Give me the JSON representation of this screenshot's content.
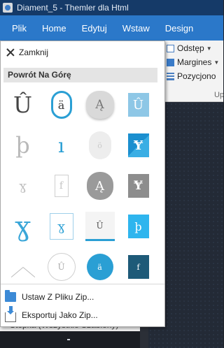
{
  "window": {
    "title": "Diament_5 - Themler dla Html"
  },
  "menu": [
    {
      "label": "Plik"
    },
    {
      "label": "Home"
    },
    {
      "label": "Edytuj"
    },
    {
      "label": "Wstaw"
    },
    {
      "label": "Design"
    }
  ],
  "ribbon": {
    "spacing_label": "Odstęp",
    "margins_label": "Margines",
    "position_label": "Pozycjono",
    "group_label": "Up"
  },
  "panel": {
    "close_label": "Zamknij",
    "section_title": "Powrót Na Górę",
    "styles": [
      {
        "glyph": "Û"
      },
      {
        "glyph": "ä"
      },
      {
        "glyph": "Ą"
      },
      {
        "glyph": "Û"
      },
      {
        "glyph": "þ"
      },
      {
        "glyph": "ı"
      },
      {
        "glyph": "ö"
      },
      {
        "glyph": "Ɏ"
      },
      {
        "glyph": "ɣ"
      },
      {
        "glyph": "f"
      },
      {
        "glyph": "Ą"
      },
      {
        "glyph": "Ɏ"
      },
      {
        "glyph": "ɣ"
      },
      {
        "glyph": "ɣ"
      },
      {
        "glyph": "Û"
      },
      {
        "glyph": "þ"
      },
      {
        "glyph": ""
      },
      {
        "glyph": "Û"
      },
      {
        "glyph": "ä"
      },
      {
        "glyph": "f"
      }
    ],
    "actions": {
      "load_zip": "Ustaw Z Pliku Zip...",
      "export_zip": "Eksportuj Jako Zip..."
    }
  },
  "background": {
    "partial_item": "Stopka (Wszystkie Szablony)"
  },
  "colors": {
    "accent": "#2a9fd4",
    "menubar": "#2b78c9",
    "titlebar": "#153a68"
  }
}
